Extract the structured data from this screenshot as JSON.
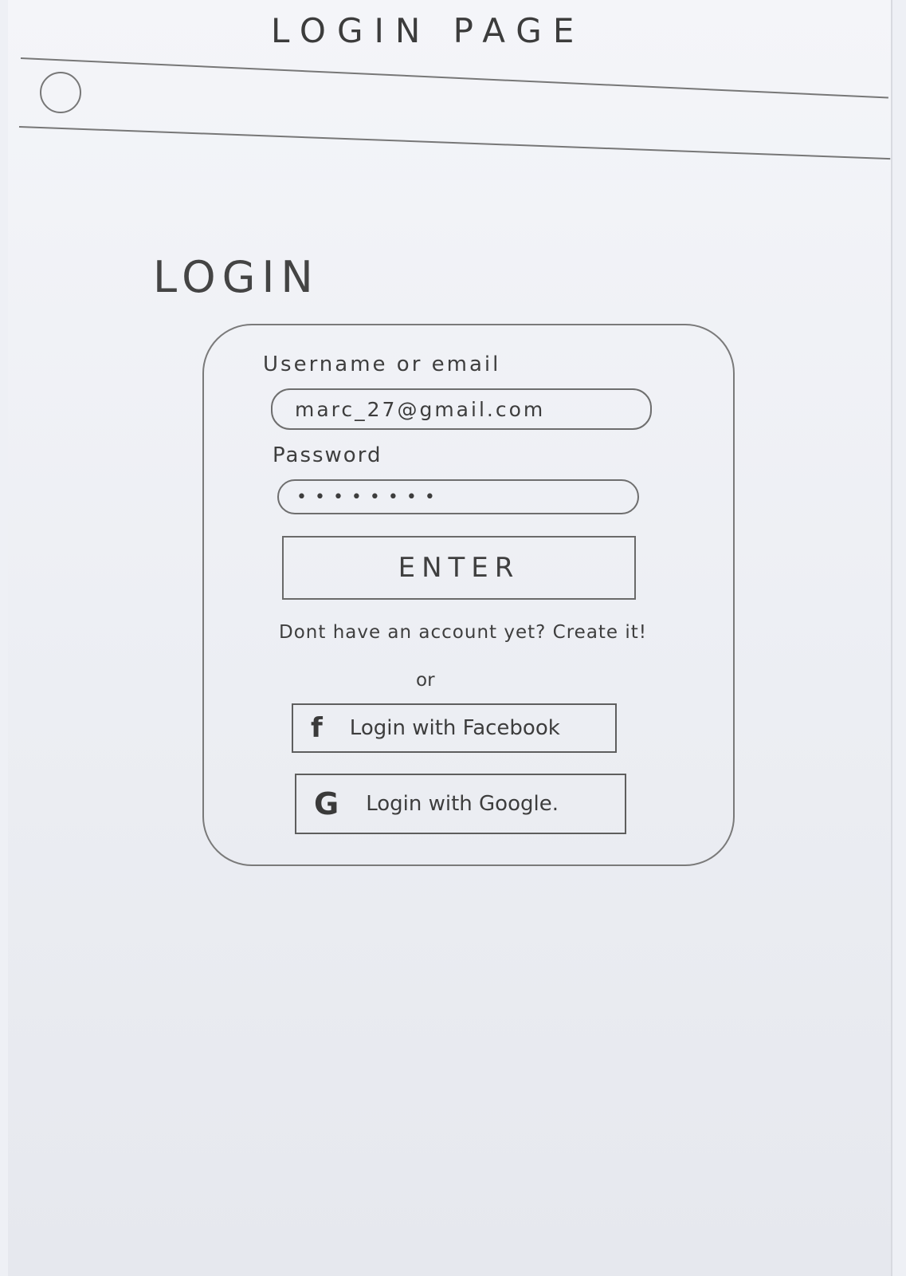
{
  "header": {
    "title": "LOGIN PAGE"
  },
  "icons": {
    "menu": "circle-icon",
    "facebook": "facebook-icon",
    "google": "google-icon"
  },
  "main": {
    "heading": "LOGIN",
    "username_label": "Username or email",
    "username_value": "marc_27@gmail.com",
    "password_label": "Password",
    "password_value": "••••••••",
    "enter_label": "ENTER",
    "signup_text": "Dont have an account yet? Create it!",
    "or_text": "or",
    "facebook_icon_glyph": "f",
    "facebook_label": "Login with Facebook",
    "google_icon_glyph": "G",
    "google_label": "Login with Google."
  }
}
